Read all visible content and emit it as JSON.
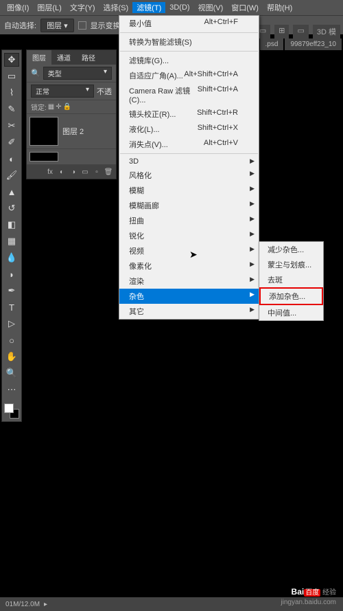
{
  "menubar": [
    "图像(I)",
    "图层(L)",
    "文字(Y)",
    "选择(S)",
    "滤镜(T)",
    "3D(D)",
    "视图(V)",
    "窗口(W)",
    "帮助(H)"
  ],
  "active_menu_index": 4,
  "optionbar": {
    "label": "自动选择:",
    "select": "图层",
    "checkbox_label": "显示变换"
  },
  "right_controls": [
    "",
    "",
    "",
    "3D 模"
  ],
  "tabs": [
    ".psd",
    "99879eff23_10"
  ],
  "panel": {
    "tabs": [
      "图层",
      "通道",
      "路径"
    ],
    "kind_label": "类型",
    "search": "",
    "blend": "正常",
    "opacity_label": "不透",
    "lock_label": "锁定:",
    "layer_name": "图层 2"
  },
  "filter_menu": [
    {
      "label": "最小值",
      "shortcut": "Alt+Ctrl+F"
    },
    {
      "sep": true
    },
    {
      "label": "转换为智能滤镜(S)"
    },
    {
      "sep": true
    },
    {
      "label": "滤镜库(G)..."
    },
    {
      "label": "自适应广角(A)...",
      "shortcut": "Alt+Shift+Ctrl+A"
    },
    {
      "label": "Camera Raw 滤镜(C)...",
      "shortcut": "Shift+Ctrl+A"
    },
    {
      "label": "镜头校正(R)...",
      "shortcut": "Shift+Ctrl+R"
    },
    {
      "label": "液化(L)...",
      "shortcut": "Shift+Ctrl+X"
    },
    {
      "label": "消失点(V)...",
      "shortcut": "Alt+Ctrl+V"
    },
    {
      "sep": true
    },
    {
      "label": "3D",
      "sub": true
    },
    {
      "label": "风格化",
      "sub": true
    },
    {
      "label": "模糊",
      "sub": true
    },
    {
      "label": "模糊画廊",
      "sub": true
    },
    {
      "label": "扭曲",
      "sub": true
    },
    {
      "label": "锐化",
      "sub": true
    },
    {
      "label": "视频",
      "sub": true
    },
    {
      "label": "像素化",
      "sub": true
    },
    {
      "label": "渲染",
      "sub": true
    },
    {
      "label": "杂色",
      "sub": true,
      "hover": true
    },
    {
      "label": "其它",
      "sub": true
    }
  ],
  "noise_submenu": [
    "减少杂色...",
    "蒙尘与划痕...",
    "去斑",
    "添加杂色...",
    "中间值..."
  ],
  "highlighted_submenu_index": 3,
  "status": "01M/12.0M",
  "watermark": {
    "brand": "Bai",
    "du": "百度",
    "suffix": "经验",
    "url": "jingyan.baidu.com"
  }
}
